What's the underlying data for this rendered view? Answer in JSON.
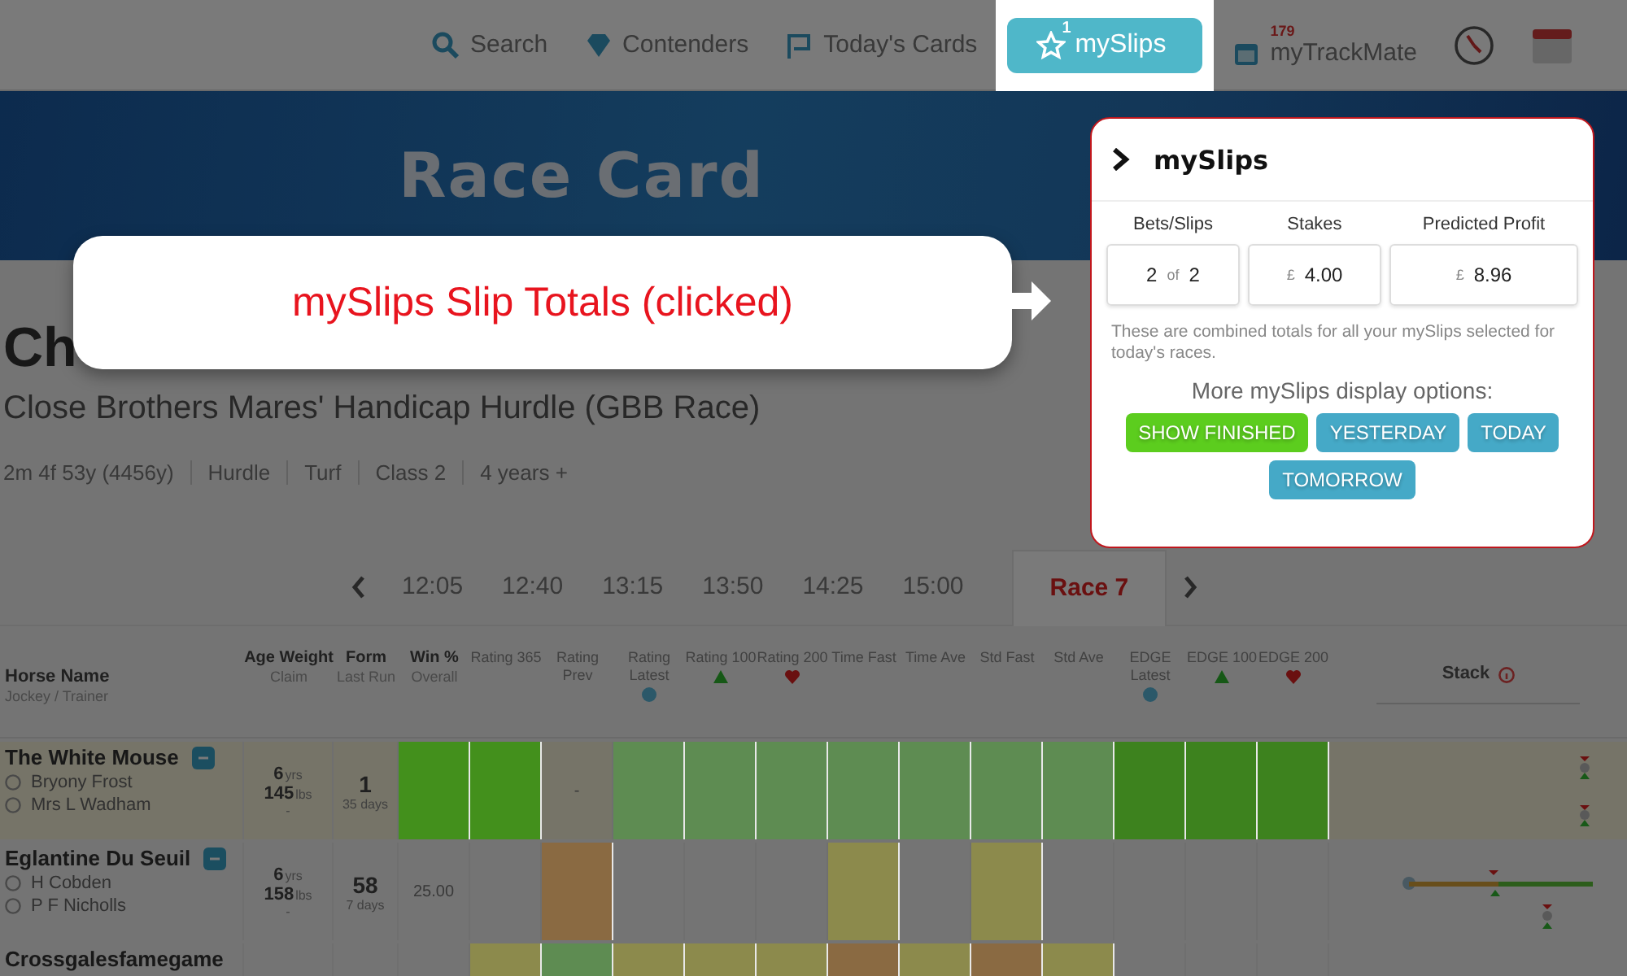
{
  "nav": {
    "items": [
      {
        "kind": "link",
        "label": "Search",
        "selected": false
      },
      {
        "kind": "link",
        "label": "Contenders",
        "selected": false
      },
      {
        "kind": "link",
        "label": "Today's Cards",
        "selected": false
      },
      {
        "kind": "link",
        "label": "mySlips",
        "count": "1",
        "selected": true
      },
      {
        "kind": "link",
        "label": "myTrackMate",
        "count": "179",
        "selected": false
      },
      {
        "kind": "icon",
        "selected": false
      },
      {
        "kind": "icon",
        "selected": false
      }
    ]
  },
  "banner": {
    "title": "Race Card"
  },
  "race": {
    "course": "Ch",
    "name": "Close Brothers Mares' Handicap Hurdle (GBB Race)",
    "details": [
      "2m 4f 53y (4456y)",
      "Hurdle",
      "Turf",
      "Class 2",
      "4 years +"
    ]
  },
  "race_tabs": {
    "times": [
      {
        "label": "12:05",
        "selected": false
      },
      {
        "label": "12:40",
        "selected": false
      },
      {
        "label": "13:15",
        "selected": false
      },
      {
        "label": "13:50",
        "selected": false
      },
      {
        "label": "14:25",
        "selected": false
      },
      {
        "label": "15:00",
        "selected": false
      },
      {
        "label": "Race 7",
        "selected": true
      }
    ]
  },
  "table": {
    "columns": [
      {
        "kind": "plain",
        "title": "Horse Name",
        "sub": "Jockey / Trainer"
      },
      {
        "kind": "plain",
        "title": "Age Weight",
        "sub": "Claim"
      },
      {
        "kind": "plain",
        "title": "Form",
        "sub": "Last Run"
      },
      {
        "kind": "plain",
        "title": "Win %",
        "sub": "Overall"
      },
      {
        "kind": "plain",
        "title": "Rating 365"
      },
      {
        "kind": "plain",
        "title": "Rating Prev"
      },
      {
        "kind": "dot",
        "title": "Rating Latest"
      },
      {
        "kind": "triangle",
        "title": "Rating 100"
      },
      {
        "kind": "heart",
        "title": "Rating 200"
      },
      {
        "kind": "plain",
        "title": "Time Fast"
      },
      {
        "kind": "plain",
        "title": "Time Ave"
      },
      {
        "kind": "plain",
        "title": "Std Fast"
      },
      {
        "kind": "plain",
        "title": "Std Ave"
      },
      {
        "kind": "dot",
        "title": "EDGE Latest"
      },
      {
        "kind": "triangle",
        "title": "EDGE 100"
      },
      {
        "kind": "heart",
        "title": "EDGE 200"
      },
      {
        "kind": "info",
        "title": "Stack"
      }
    ],
    "rows": [
      {
        "kind": "markers",
        "name": "The White Mouse",
        "highlight": true,
        "jockey": "Bryony Frost",
        "trainer": "Mrs L Wadham",
        "age": "6",
        "age_unit": "yrs",
        "weight": "145",
        "weight_unit": "lbs",
        "claim": "-",
        "form": "1",
        "last_run": "35 days",
        "scores": [
          {
            "color": "#43901c"
          },
          {
            "color": "#43901c"
          },
          {
            "text": "-"
          },
          {
            "color": "#5e8c52"
          },
          {
            "color": "#5e8c52"
          },
          {
            "color": "#5e8c52"
          },
          {
            "color": "#5e8c52"
          },
          {
            "color": "#5e8c52"
          },
          {
            "color": "#5e8c52"
          },
          {
            "color": "#5e8c52"
          },
          {
            "color": "#3d821e"
          },
          {
            "color": "#3d821e"
          },
          {
            "color": "#3d821e"
          }
        ]
      },
      {
        "kind": "range",
        "name": "Eglantine Du Seuil",
        "highlight": false,
        "jockey": "H Cobden",
        "trainer": "P F Nicholls",
        "age": "6",
        "age_unit": "yrs",
        "weight": "158",
        "weight_unit": "lbs",
        "claim": "-",
        "form": "58",
        "last_run": "7 days",
        "scores": [
          {
            "kind": "value",
            "text": "25.00"
          },
          {
            "kind": "blank"
          },
          {
            "kind": "shaded",
            "color": "#8a6a42"
          },
          {
            "kind": "blank"
          },
          {
            "kind": "blank"
          },
          {
            "kind": "blank"
          },
          {
            "kind": "shaded",
            "color": "#8c8a4c"
          },
          {
            "kind": "blank"
          },
          {
            "kind": "shaded",
            "color": "#8c8a4c"
          },
          {
            "kind": "blank"
          },
          {
            "kind": "blank"
          },
          {
            "kind": "blank"
          },
          {
            "kind": "blank"
          }
        ]
      },
      {
        "kind": "marker",
        "name": "Crossgalesfamegame",
        "highlight": false,
        "scores": [
          {
            "kind": "blank"
          },
          {
            "color": "#8c8a4c"
          },
          {
            "color": "#5e8c52"
          },
          {
            "color": "#8c8a4c"
          },
          {
            "color": "#8c8a4c"
          },
          {
            "color": "#8c8a4c"
          },
          {
            "color": "#8a6a42"
          },
          {
            "color": "#8c8a4c"
          },
          {
            "color": "#8a6a42"
          },
          {
            "color": "#8c8a4c"
          },
          {
            "kind": "blank"
          },
          {
            "kind": "blank"
          },
          {
            "kind": "blank"
          }
        ]
      }
    ]
  },
  "callout": {
    "text": "mySlips Slip Totals (clicked)"
  },
  "popup": {
    "title": "mySlips",
    "totals": [
      {
        "kind": "count",
        "label": "Bets/Slips",
        "value": "2",
        "joiner": "of",
        "total": "2"
      },
      {
        "kind": "money",
        "label": "Stakes",
        "currency": "£",
        "value": "4.00"
      },
      {
        "kind": "money",
        "label": "Predicted Profit",
        "currency": "£",
        "value": "8.96"
      }
    ],
    "note": "These are combined totals for all your mySlips selected for today's races.",
    "options_title": "More mySlips display options:",
    "options": [
      {
        "label": "SHOW FINISHED",
        "on": true
      },
      {
        "label": "YESTERDAY",
        "on": false
      },
      {
        "label": "TODAY",
        "on": false
      },
      {
        "label": "TOMORROW",
        "on": false
      }
    ]
  }
}
